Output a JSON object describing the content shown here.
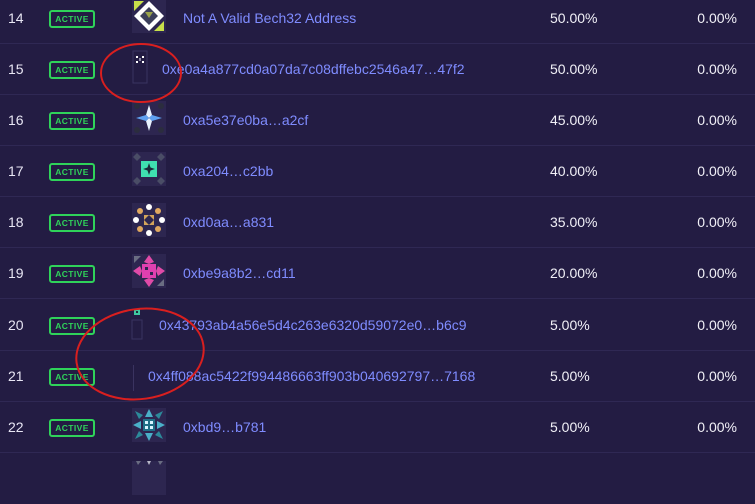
{
  "status_label": "ACTIVE",
  "colors": {
    "background": "#231c43",
    "active": "#2fd35a",
    "link": "#7f8cff",
    "annotation": "#d91f1f"
  },
  "rows": [
    {
      "rank": "14",
      "status": "ACTIVE",
      "icon": "validator-avatar-icon",
      "name": "Not A Valid Bech32 Address",
      "commission": "50.00%",
      "uptime": "0.00%"
    },
    {
      "rank": "15",
      "status": "ACTIVE",
      "icon": "validator-avatar-icon",
      "name": "0xe0a4a877cd0a07da7c08dffebc2546a47…47f2",
      "commission": "50.00%",
      "uptime": "0.00%"
    },
    {
      "rank": "16",
      "status": "ACTIVE",
      "icon": "validator-avatar-icon",
      "name": "0xa5e37e0ba…a2cf",
      "commission": "45.00%",
      "uptime": "0.00%"
    },
    {
      "rank": "17",
      "status": "ACTIVE",
      "icon": "validator-avatar-icon",
      "name": "0xa204…c2bb",
      "commission": "40.00%",
      "uptime": "0.00%"
    },
    {
      "rank": "18",
      "status": "ACTIVE",
      "icon": "validator-avatar-icon",
      "name": "0xd0aa…a831",
      "commission": "35.00%",
      "uptime": "0.00%"
    },
    {
      "rank": "19",
      "status": "ACTIVE",
      "icon": "validator-avatar-icon",
      "name": "0xbe9a8b2…cd11",
      "commission": "20.00%",
      "uptime": "0.00%"
    },
    {
      "rank": "20",
      "status": "ACTIVE",
      "icon": "validator-avatar-icon",
      "name": "0x43793ab4a56e5d4c263e6320d59072e0…b6c9",
      "commission": "5.00%",
      "uptime": "0.00%"
    },
    {
      "rank": "21",
      "status": "ACTIVE",
      "icon": "validator-avatar-icon",
      "name": "0x4ff088ac5422f994486663ff903b040692797…7168",
      "commission": "5.00%",
      "uptime": "0.00%"
    },
    {
      "rank": "22",
      "status": "ACTIVE",
      "icon": "validator-avatar-icon",
      "name": "0xbd9…b781",
      "commission": "5.00%",
      "uptime": "0.00%"
    }
  ]
}
